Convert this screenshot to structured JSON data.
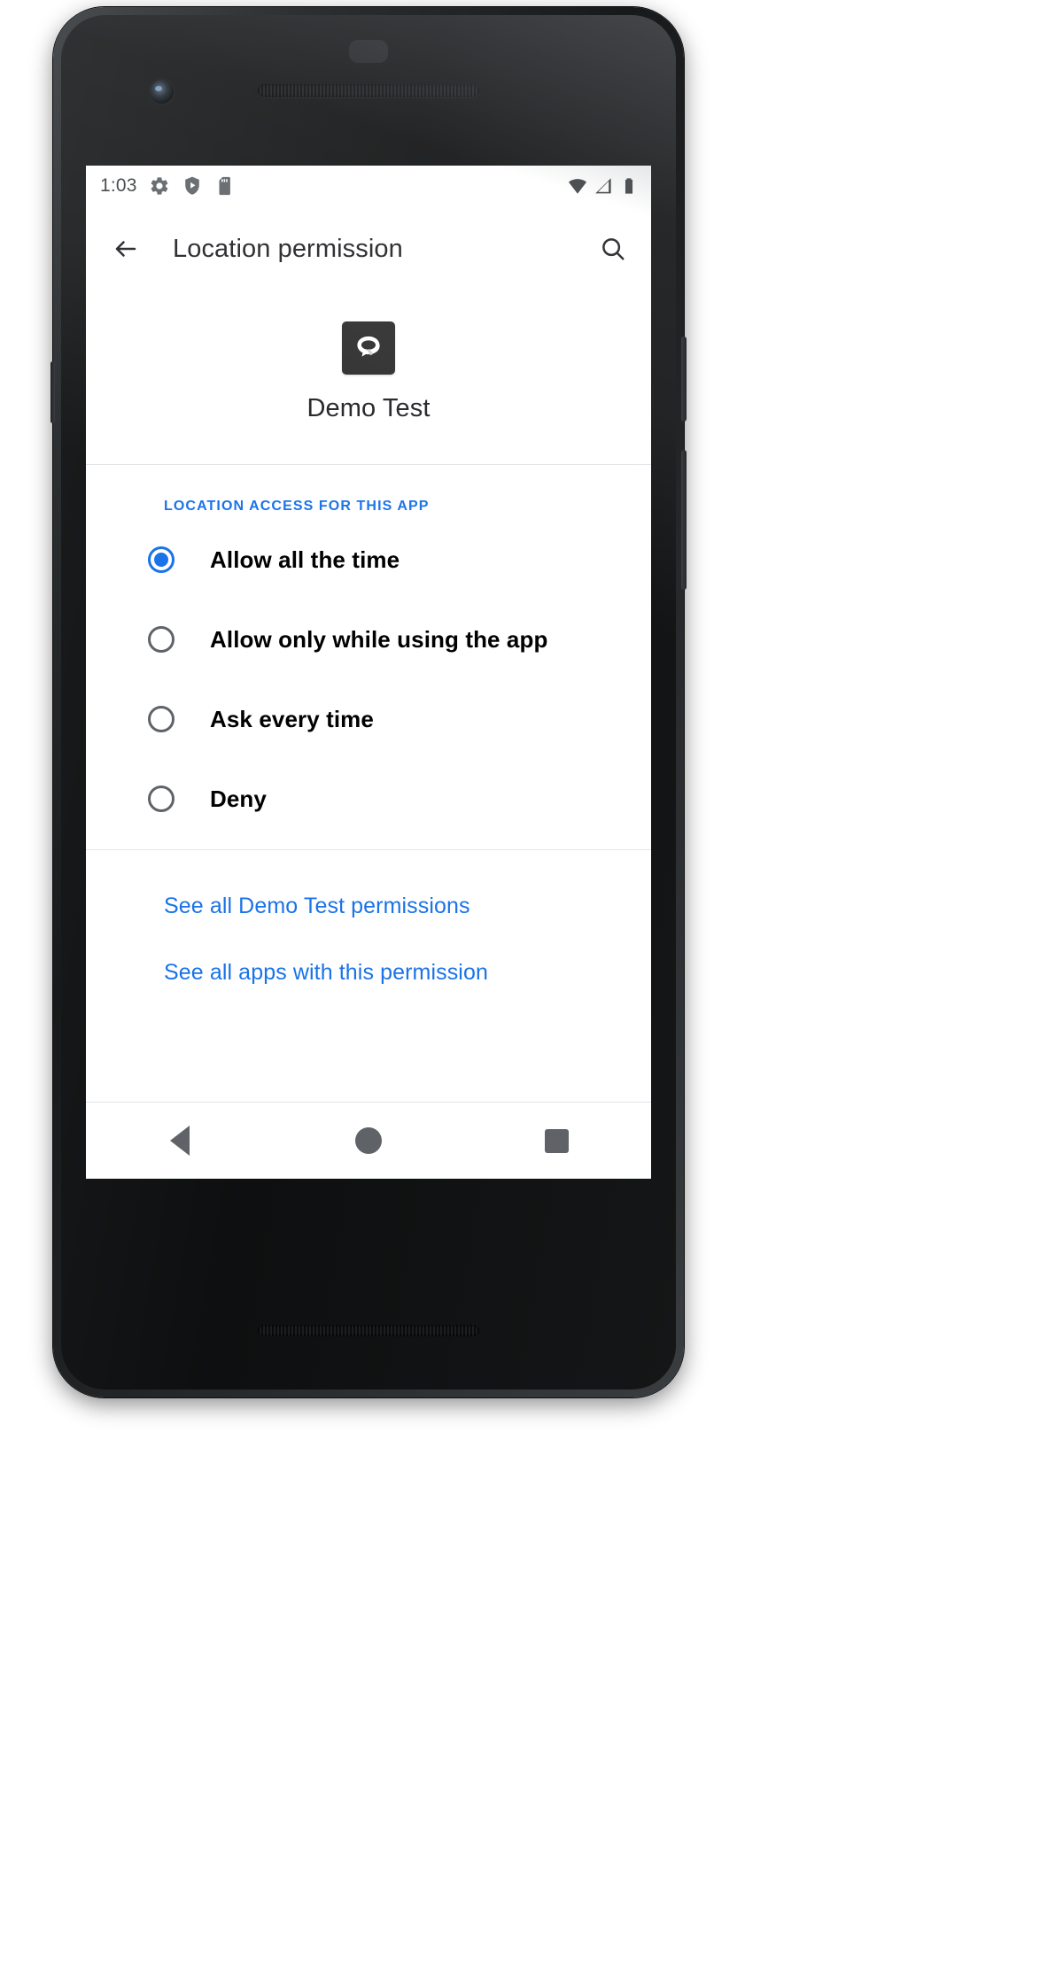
{
  "statusbar": {
    "time": "1:03",
    "left_icons": [
      {
        "name": "gear-icon",
        "label": "Settings"
      },
      {
        "name": "shield-play-icon",
        "label": "Protected media"
      },
      {
        "name": "sd-card-icon",
        "label": "SD card"
      }
    ],
    "right_icons": [
      {
        "name": "wifi-icon",
        "label": "Wi-Fi"
      },
      {
        "name": "cell-signal-icon",
        "label": "Cellular signal"
      },
      {
        "name": "battery-icon",
        "label": "Battery"
      }
    ]
  },
  "appbar": {
    "back_label": "Navigate up",
    "title": "Location permission",
    "search_label": "Search"
  },
  "app_header": {
    "icon_name": "demo-test-app-icon",
    "app_name": "Demo Test"
  },
  "section": {
    "title": "LOCATION ACCESS FOR THIS APP",
    "accent_color": "#1a73e8",
    "options": [
      {
        "label": "Allow all the time",
        "selected": true
      },
      {
        "label": "Allow only while using the app",
        "selected": false
      },
      {
        "label": "Ask every time",
        "selected": false
      },
      {
        "label": "Deny",
        "selected": false
      }
    ]
  },
  "links": [
    {
      "label": "See all Demo Test permissions"
    },
    {
      "label": "See all apps with this permission"
    }
  ],
  "navbar": {
    "back_label": "Back",
    "home_label": "Home",
    "recents_label": "Recents"
  },
  "colors": {
    "accent": "#1a73e8",
    "text_primary": "#202124",
    "text_secondary": "#5f6368",
    "divider": "#e2e5e8",
    "surface": "#ffffff"
  }
}
